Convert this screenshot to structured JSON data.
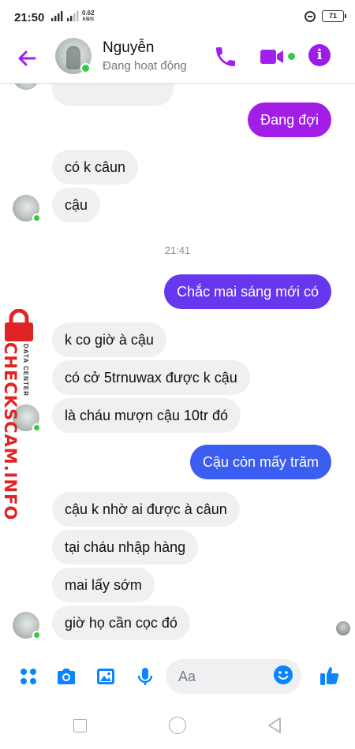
{
  "status_bar": {
    "time": "21:50",
    "speed_value": "0.62",
    "speed_unit": "KB/S",
    "battery": "71"
  },
  "header": {
    "contact_name": "Nguyễn",
    "contact_status": "Đang hoạt động"
  },
  "colors": {
    "accent": "#a020f0",
    "outgoing_purple": "#a21de6",
    "outgoing_indigo": "#6637ee",
    "outgoing_blue": "#3b5ef0",
    "online_green": "#31cc46",
    "watermark_red": "#e02424"
  },
  "messages": [
    {
      "side": "out",
      "text": "Đang đợi"
    },
    {
      "side": "in",
      "text": "có k câun"
    },
    {
      "side": "in",
      "text": "cậu"
    },
    {
      "side": "time",
      "text": "21:41"
    },
    {
      "side": "out",
      "text": "Chắc mai sáng mới có"
    },
    {
      "side": "in",
      "text": "k co giờ à cậu"
    },
    {
      "side": "in",
      "text": "có cở 5trnuwax được k cậu"
    },
    {
      "side": "in",
      "text": "là cháu mượn cậu 10tr đó"
    },
    {
      "side": "out",
      "text": "Cậu còn mấy trăm"
    },
    {
      "side": "in",
      "text": "cậu k nhờ ai được à câun"
    },
    {
      "side": "in",
      "text": "tại cháu nhập hàng"
    },
    {
      "side": "in",
      "text": "mai lấy sớm"
    },
    {
      "side": "in",
      "text": "giờ họ cần cọc đó"
    }
  ],
  "watermark": {
    "brand": "CHECKSCAM.INFO",
    "tagline": "DATA CENTER"
  },
  "composer": {
    "placeholder": "Aa"
  },
  "icons": [
    "back-arrow-icon",
    "phone-icon",
    "video-camera-icon",
    "info-icon",
    "apps-grid-icon",
    "camera-icon",
    "image-icon",
    "microphone-icon",
    "emoji-icon",
    "thumbs-up-icon",
    "lock-icon"
  ]
}
